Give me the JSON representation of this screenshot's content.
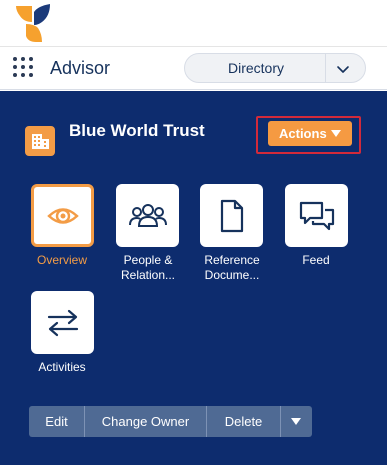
{
  "app": {
    "name": "Advisor",
    "selector": {
      "label": "Directory"
    }
  },
  "record": {
    "title": "Blue World Trust",
    "actions_label": "Actions"
  },
  "tiles": [
    {
      "label": "Overview",
      "icon": "eye-icon",
      "selected": true
    },
    {
      "label": "People & Relation...",
      "icon": "people-icon",
      "selected": false
    },
    {
      "label": "Reference Docume...",
      "icon": "document-icon",
      "selected": false
    },
    {
      "label": "Feed",
      "icon": "chat-icon",
      "selected": false
    },
    {
      "label": "Activities",
      "icon": "swap-arrows-icon",
      "selected": false
    }
  ],
  "buttons": {
    "edit": "Edit",
    "change_owner": "Change Owner",
    "delete": "Delete"
  },
  "colors": {
    "panel_bg": "#0d2c6e",
    "accent_orange": "#f39c46",
    "highlight_red": "#d22a3a",
    "button_group": "#4f6a94"
  }
}
